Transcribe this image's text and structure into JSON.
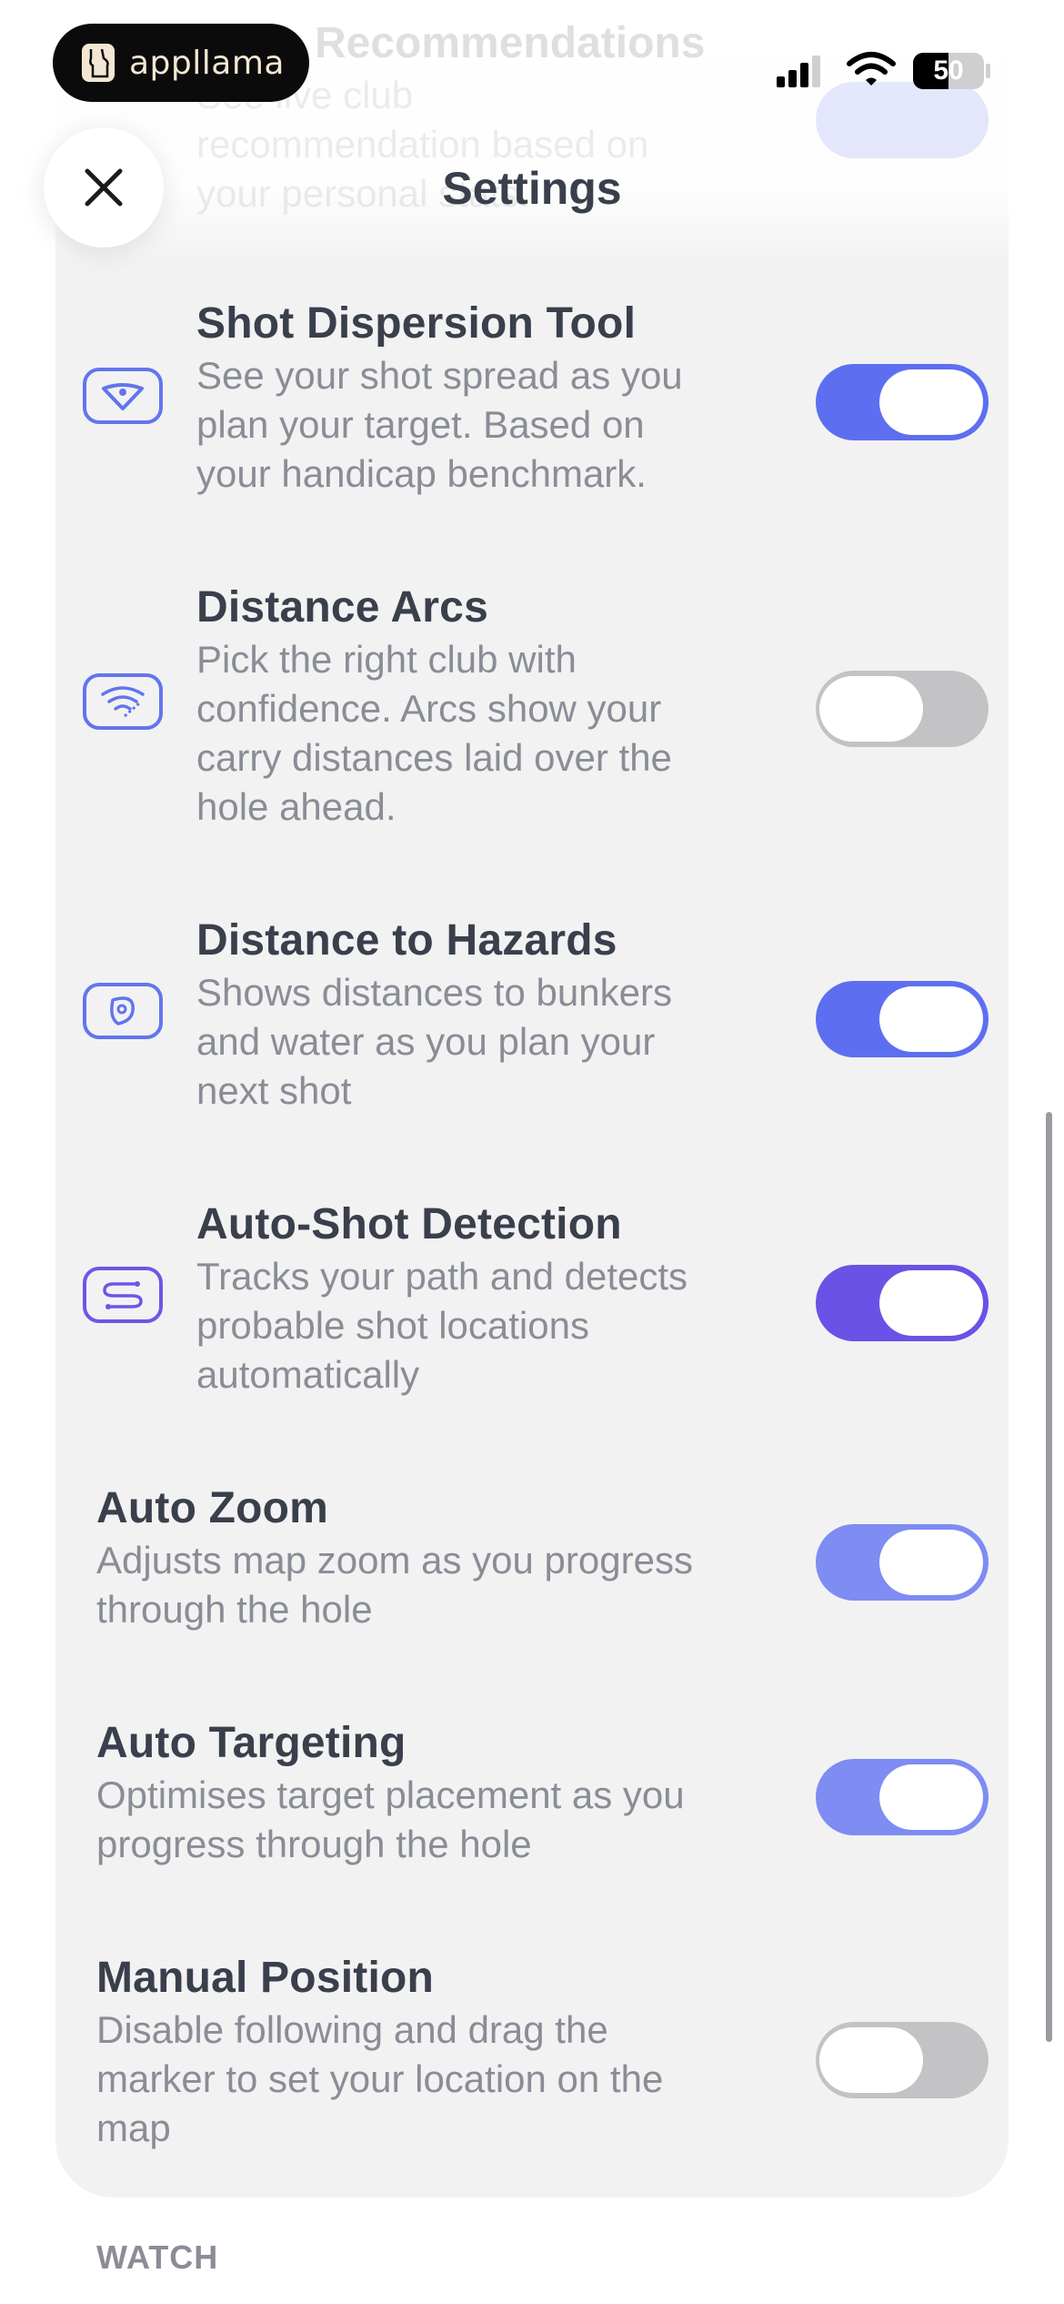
{
  "status_bar": {
    "brand": "appllama",
    "battery": "50"
  },
  "header": {
    "title": "Settings",
    "faded_row": {
      "title": "Recommendations",
      "desc_lines": [
        "See live club",
        "recommendation based on",
        "your personal stats."
      ]
    }
  },
  "settings": [
    {
      "title": "Shot Dispersion Tool",
      "desc_lines": [
        "See your shot spread as you",
        "plan your target. Based on",
        "your handicap benchmark."
      ],
      "enabled": true,
      "icon": "shot-dispersion-icon"
    },
    {
      "title": "Distance Arcs",
      "desc_lines": [
        "Pick the right club with",
        "confidence. Arcs show your",
        "carry distances laid over the",
        "hole ahead."
      ],
      "enabled": false,
      "icon": "distance-arcs-icon"
    },
    {
      "title": "Distance to Hazards",
      "desc_lines": [
        "Shows distances to bunkers",
        "and water as you plan your",
        "next shot"
      ],
      "enabled": true,
      "icon": "hazard-icon"
    },
    {
      "title": "Auto-Shot Detection",
      "desc_lines": [
        "Tracks your path and detects",
        "probable shot locations",
        "automatically"
      ],
      "enabled": true,
      "icon": "shot-path-icon"
    },
    {
      "title": "Auto Zoom",
      "desc_lines": [
        "Adjusts map zoom as you progress",
        "through the hole"
      ],
      "enabled": true
    },
    {
      "title": "Auto Targeting",
      "desc_lines": [
        "Optimises target placement as you",
        "progress through the hole"
      ],
      "enabled": true
    },
    {
      "title": "Manual Position",
      "desc_lines": [
        "Disable following and drag the",
        "marker to set your location on the",
        "map"
      ],
      "enabled": false
    }
  ],
  "section_footer": "WATCH",
  "colors": {
    "accent": "#5d6ff0",
    "accent_violet": "#6a52e6",
    "toggle_off": "#c3c3c5",
    "card_bg": "#f2f2f3",
    "title_text": "#3a3f4c",
    "desc_text": "#8a8d96"
  }
}
